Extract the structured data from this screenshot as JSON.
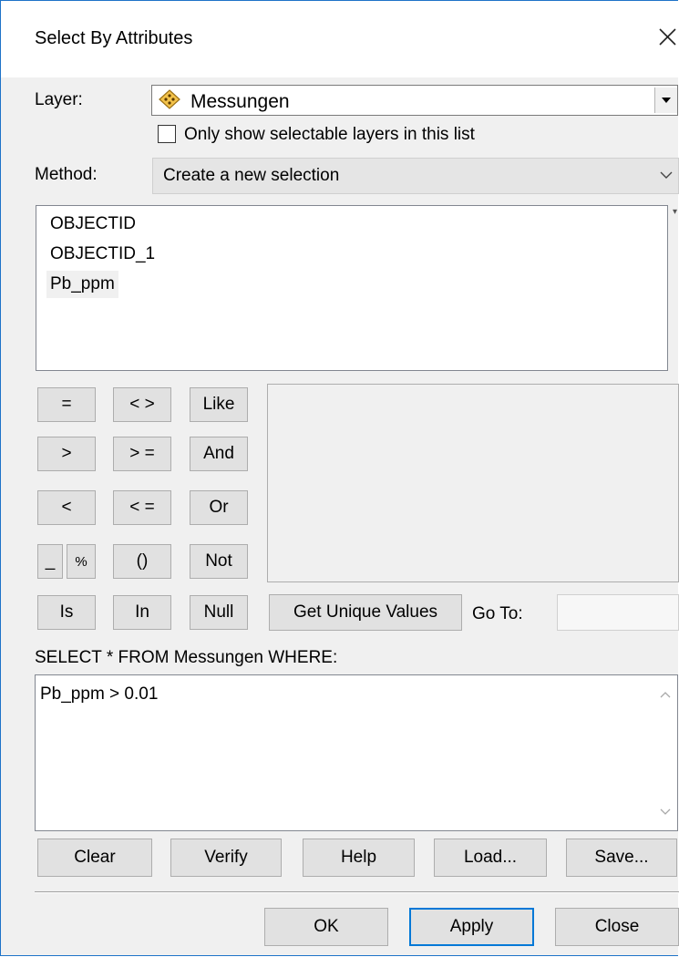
{
  "window": {
    "title": "Select By Attributes"
  },
  "layer": {
    "label": "Layer:",
    "value": "Messungen",
    "icon": "point-layer-icon",
    "only_selectable_label": "Only show selectable layers in this list",
    "only_selectable_checked": false
  },
  "method": {
    "label": "Method:",
    "value": "Create a new selection"
  },
  "fields": [
    {
      "name": "OBJECTID",
      "selected": false
    },
    {
      "name": "OBJECTID_1",
      "selected": false
    },
    {
      "name": "Pb_ppm",
      "selected": true
    }
  ],
  "operators": {
    "eq": "=",
    "ne": "< >",
    "like": "Like",
    "gt": ">",
    "ge": "> =",
    "and": "And",
    "lt": "<",
    "le": "< =",
    "or": "Or",
    "underscore": "_",
    "percent": "%",
    "parens": "()",
    "not": "Not",
    "is": "Is",
    "in": "In",
    "null": "Null"
  },
  "unique_values": {
    "button_label": "Get Unique Values",
    "goto_label": "Go To:",
    "goto_value": ""
  },
  "query": {
    "prefix_label": "SELECT * FROM Messungen WHERE:",
    "expression": "Pb_ppm > 0.01"
  },
  "actions": {
    "clear": "Clear",
    "verify": "Verify",
    "help": "Help",
    "load": "Load...",
    "save": "Save..."
  },
  "footer": {
    "ok": "OK",
    "apply": "Apply",
    "close": "Close"
  },
  "colors": {
    "accent": "#0078d7",
    "window_border": "#1e73c8",
    "dialog_bg": "#f0f0f0",
    "layer_icon_fill": "#f3c24a"
  }
}
